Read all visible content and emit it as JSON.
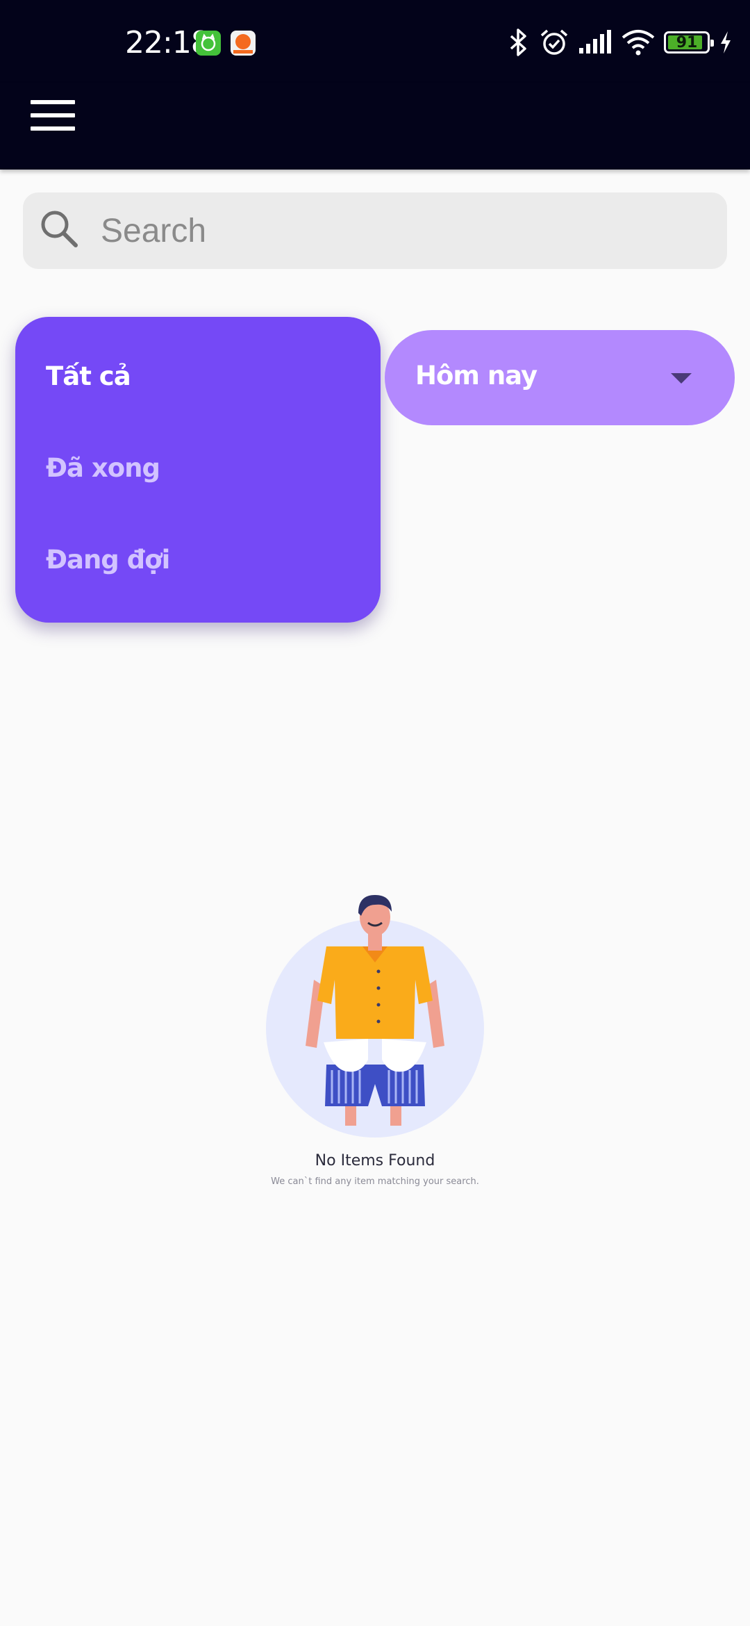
{
  "status_bar": {
    "time": "22:18",
    "notification_icons": [
      "cat-app-icon",
      "orange-app-icon"
    ],
    "icons": [
      "bluetooth-icon",
      "alarm-icon",
      "signal-icon",
      "wifi-icon",
      "battery-icon",
      "charging-icon"
    ],
    "battery_level": "91"
  },
  "app_bar": {
    "menu_icon": "hamburger-menu-icon"
  },
  "search": {
    "placeholder": "Search",
    "icon": "search-icon"
  },
  "filter_menu": {
    "items": [
      {
        "label": "Tất cả",
        "selected": true
      },
      {
        "label": "Đã xong",
        "selected": false
      },
      {
        "label": "Đang đợi",
        "selected": false
      }
    ]
  },
  "date_filter": {
    "selected": "Hôm nay",
    "icon": "caret-down-icon"
  },
  "empty_state": {
    "title": "No Items Found",
    "subtitle": "We can`t find any item matching your search."
  },
  "colors": {
    "header_bg": "#03031a",
    "menu_bg": "#7549f6",
    "dropdown_bg": "#b389fe",
    "page_bg": "#fafafa"
  }
}
